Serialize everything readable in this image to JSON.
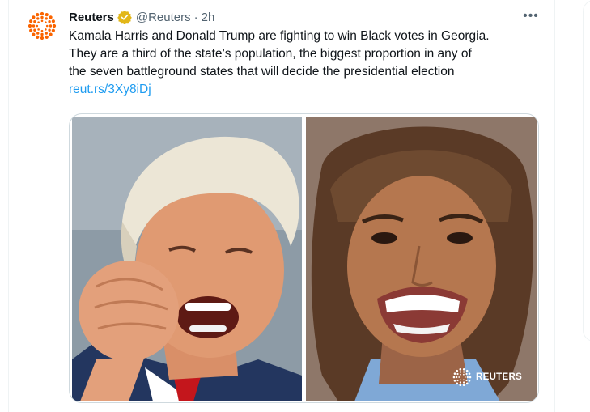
{
  "post": {
    "author_name": "Reuters",
    "author_handle": "@Reuters",
    "separator": "·",
    "timestamp": "2h",
    "more_label": "•••",
    "verified": true,
    "text_lines": [
      "Kamala Harris and Donald Trump are fighting to win Black votes in Georgia.",
      "They are a third of the state’s population, the biggest proportion in any of",
      "the seven battleground states that will decide the presidential election"
    ],
    "link_text": "reut.rs/3Xy8iDj"
  },
  "media": {
    "watermark_text": "REUTERS",
    "images": [
      "photo-trump",
      "photo-harris"
    ]
  },
  "colors": {
    "text_primary": "#0f1419",
    "text_secondary": "#536471",
    "link": "#1d9bf0",
    "verified_gold": "#e2b719",
    "reuters_orange": "#fa6400",
    "border": "#cfd9de"
  },
  "icons": {
    "avatar": "reuters-logo-icon",
    "verified": "verified-badge-icon",
    "more": "more-options-icon",
    "watermark": "reuters-watermark-icon"
  }
}
